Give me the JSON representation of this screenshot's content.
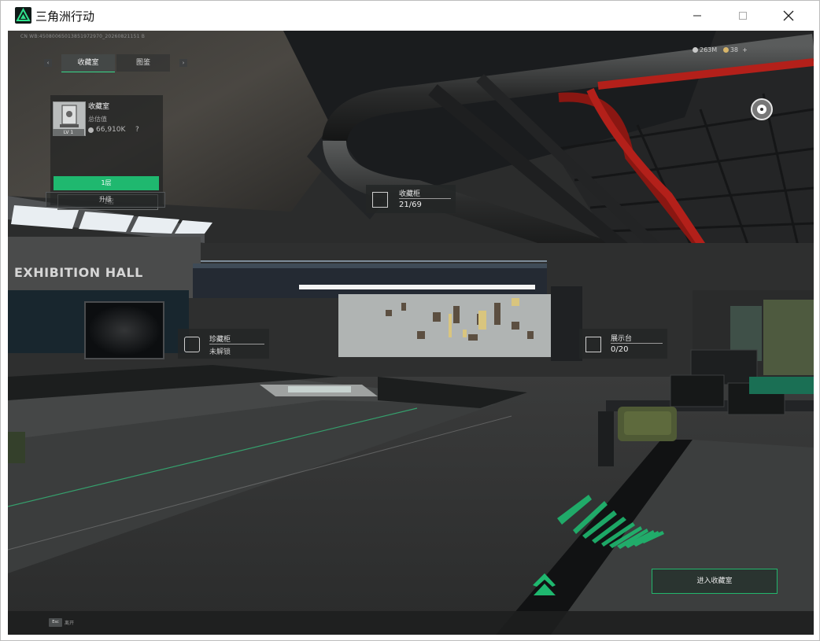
{
  "window": {
    "title": "三角洲行动"
  },
  "game": {
    "build_id": "CN WB:45080065013851972970_20260821151 B",
    "tabs": [
      {
        "label": "收藏室",
        "active": true
      },
      {
        "label": "图鉴",
        "active": false
      }
    ],
    "room": {
      "name": "收藏室",
      "level": "LV 1",
      "estimate_label": "总估值",
      "estimate_value": "66,910K",
      "help": "?"
    },
    "floors": {
      "floor_1": "1层",
      "floor_minus_1": "-1层"
    },
    "upgrade_label": "升级",
    "currency": {
      "silver": "263M",
      "gold": "38",
      "add": "+"
    },
    "markers": {
      "collection_cabinet": {
        "title": "收藏柜",
        "count": "21/69"
      },
      "rare_cabinet": {
        "title": "珍藏柜",
        "status": "未解锁"
      },
      "display_stand": {
        "title": "展示台",
        "count": "0/20"
      }
    },
    "enter_button": "进入收藏室",
    "hall_sign": "EXHIBITION HALL",
    "esc": {
      "key": "Esc",
      "label": "离开"
    },
    "colors": {
      "accent": "#1fb86f",
      "pipe_red": "#b3201a"
    }
  }
}
